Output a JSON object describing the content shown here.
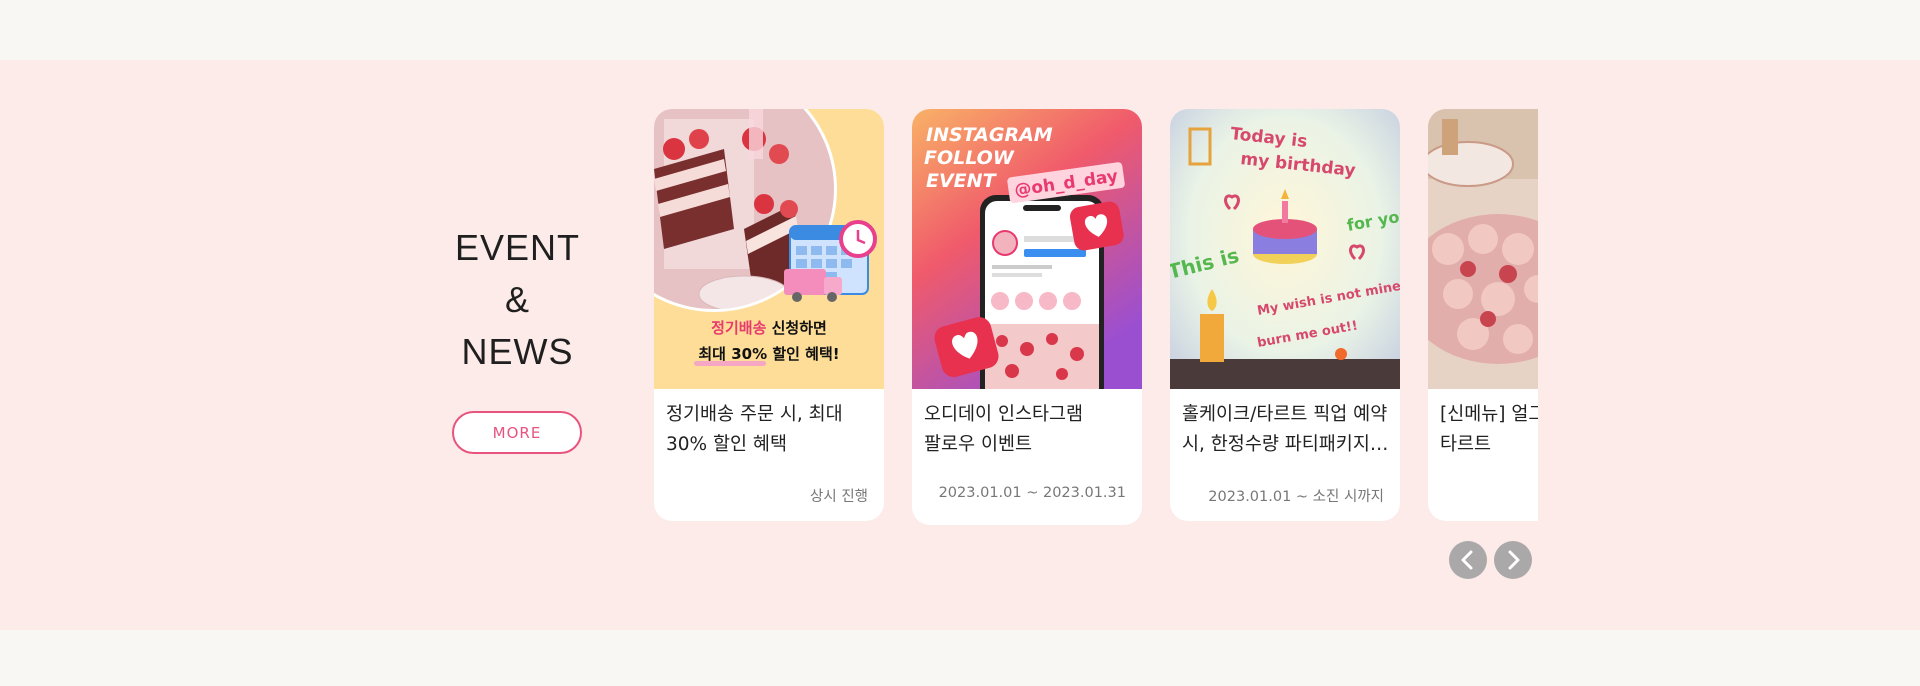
{
  "section": {
    "title_lines": [
      "EVENT",
      "&",
      "NEWS"
    ],
    "more_label": "MORE"
  },
  "cards": [
    {
      "title": "정기배송 주문 시, 최대 30% 할인 혜택",
      "date": "상시 진행",
      "image": {
        "caption_highlight": "정기배송",
        "caption_rest": " 신청하면",
        "caption_line2_bold": "최대 30%",
        "caption_line2_rest": " 할인 혜택!"
      }
    },
    {
      "title": "오디데이 인스타그램 팔로우 이벤트",
      "date": "2023.01.01 ~ 2023.01.31",
      "image": {
        "headline": [
          "INSTAGRAM",
          "FOLLOW",
          "EVENT"
        ],
        "handle": "@oh_d_day"
      }
    },
    {
      "title": "홀케이크/타르트 픽업 예약 시, 한정수량 파티패키지 증정",
      "date": "2023.01.01 ~ 소진 시까지",
      "image": {
        "lettering": [
          "Today is",
          "my birthday",
          "This is",
          "for you",
          "My wish is not mine",
          "burn me out!!"
        ]
      }
    },
    {
      "title": "[신메뉴] 얼그레이 케이크/타르트",
      "date": ""
    }
  ],
  "nav": {
    "prev_icon": "chevron-left-icon",
    "next_icon": "chevron-right-icon"
  },
  "colors": {
    "band": "#fcebe9",
    "page": "#f9f7f3",
    "accent": "#e8547e",
    "nav": "#aaa8a8"
  }
}
